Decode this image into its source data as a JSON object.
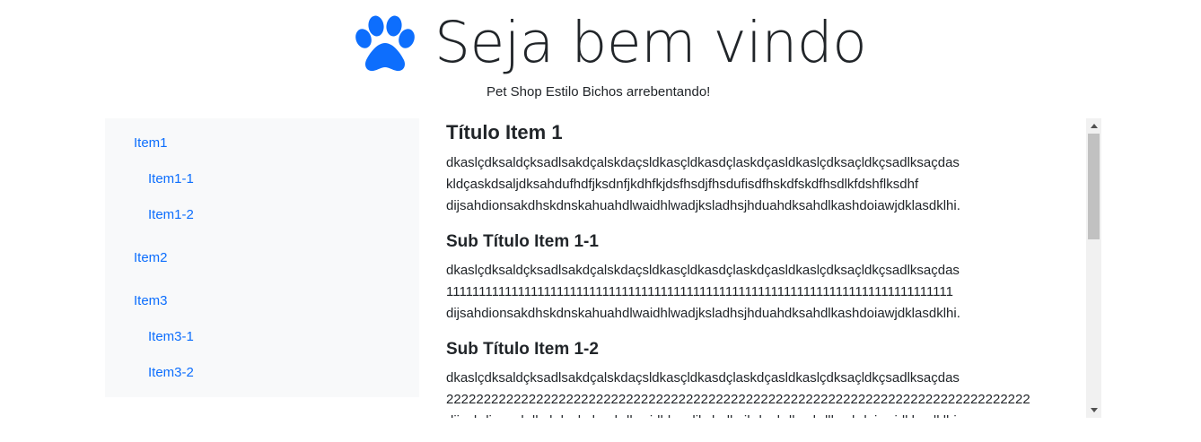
{
  "header": {
    "title": "Seja bem vindo",
    "subtitle": "Pet Shop Estilo Bichos arrebentando!",
    "logo_icon": "paw-icon",
    "accent_color": "#0d6efd"
  },
  "sidebar": {
    "items": [
      {
        "label": "Item1",
        "level": 1
      },
      {
        "label": "Item1-1",
        "level": 2
      },
      {
        "label": "Item1-2",
        "level": 2
      },
      {
        "label": "Item2",
        "level": 1
      },
      {
        "label": "Item3",
        "level": 1
      },
      {
        "label": "Item3-1",
        "level": 2
      },
      {
        "label": "Item3-2",
        "level": 2
      }
    ]
  },
  "content": {
    "sections": [
      {
        "heading": "Título Item 1",
        "lines": [
          "dkaslçdksaldçksadlsakdçalskdaçsldkasçldkasdçlaskdçasldkaslçdksaçldkçsadlksaçdas",
          "kldçaskdsaljdksahdufhdfjksdnfjkdhfkjdsfhsdjfhsdufisdfhskdfskdfhsdlkfdshflksdhf",
          "dijsahdionsakdhskdnskahuahdlwaidhlwadjksladhsjhduahdksahdlkashdoiawjdklasdklhi."
        ]
      },
      {
        "heading": "Sub Título Item 1-1",
        "lines": [
          "dkaslçdksaldçksadlsakdçalskdaçsldkasçldkasdçlaskdçasldkaslçdksaçldkçsadlksaçdas",
          "111111111111111111111111111111111111111111111111111111111111111111111111111111",
          "dijsahdionsakdhskdnskahuahdlwaidhlwadjksladhsjhduahdksahdlkashdoiawjdklasdklhi."
        ]
      },
      {
        "heading": "Sub Título Item 1-2",
        "lines": [
          "dkaslçdksaldçksadlsakdçalskdaçsldkasçldkasdçlaskdçasldkaslçdksaçldkçsadlksaçdas",
          "222222222222222222222222222222222222222222222222222222222222222222222222222222",
          "dijsahdionsakdhskdnskahuahdlwaidhlwadjksladhsjhduahdksahdlkashdoiawjdklasdklhi."
        ]
      }
    ]
  },
  "scrollbar": {
    "up_icon": "triangle-up-icon",
    "down_icon": "triangle-down-icon"
  }
}
